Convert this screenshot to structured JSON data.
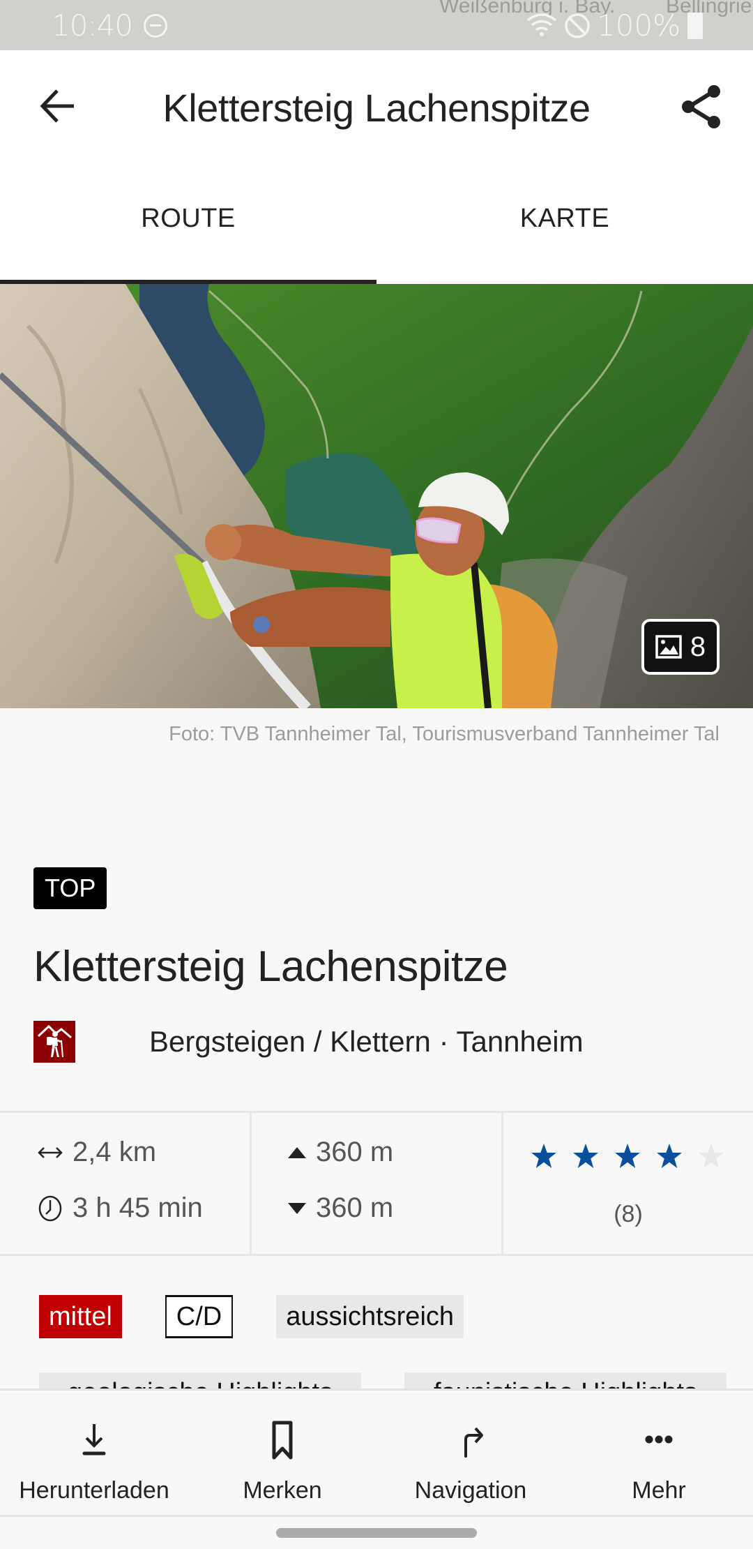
{
  "status_bar": {
    "time": "10:40",
    "battery": "100%",
    "map_labels": [
      "Weißenburg i. Bay.",
      "Bellingries"
    ],
    "icons": [
      "do-not-disturb-icon",
      "wifi-icon",
      "blocked-icon",
      "battery-icon"
    ]
  },
  "header": {
    "title": "Klettersteig Lachenspitze",
    "back_icon": "arrow-left-icon",
    "share_icon": "share-icon"
  },
  "tabs": [
    {
      "label": "ROUTE",
      "active": true
    },
    {
      "label": "KARTE",
      "active": false
    }
  ],
  "hero": {
    "gallery_count": "8",
    "gallery_icon": "image-icon",
    "credit": "Foto: TVB Tannheimer Tal, Tourismusverband Tannheimer Tal"
  },
  "route": {
    "badge": "TOP",
    "title": "Klettersteig Lachenspitze",
    "category": "Bergsteigen / Klettern · Tannheim",
    "category_icon": "hiker-mountain-icon",
    "category_color": "#8b0000"
  },
  "stats": {
    "distance": "2,4 km",
    "duration": "3 h 45 min",
    "ascent": "360 m",
    "descent": "360 m",
    "rating": 4,
    "rating_max": 5,
    "rating_count": "(8)",
    "star_color": "#0a4f9c",
    "star_empty_color": "#e8e8e8"
  },
  "tags": [
    {
      "label": "mittel",
      "style": "red"
    },
    {
      "label": "C/D",
      "style": "outline"
    },
    {
      "label": "aussichtsreich",
      "style": "grey"
    }
  ],
  "tags_partial": [
    {
      "label": "geologische Highlights"
    },
    {
      "label": "faunistische Highlights"
    }
  ],
  "bottom_nav": [
    {
      "label": "Herunterladen",
      "icon": "download-icon"
    },
    {
      "label": "Merken",
      "icon": "bookmark-icon"
    },
    {
      "label": "Navigation",
      "icon": "turn-right-icon"
    },
    {
      "label": "Mehr",
      "icon": "more-horizontal-icon"
    }
  ]
}
